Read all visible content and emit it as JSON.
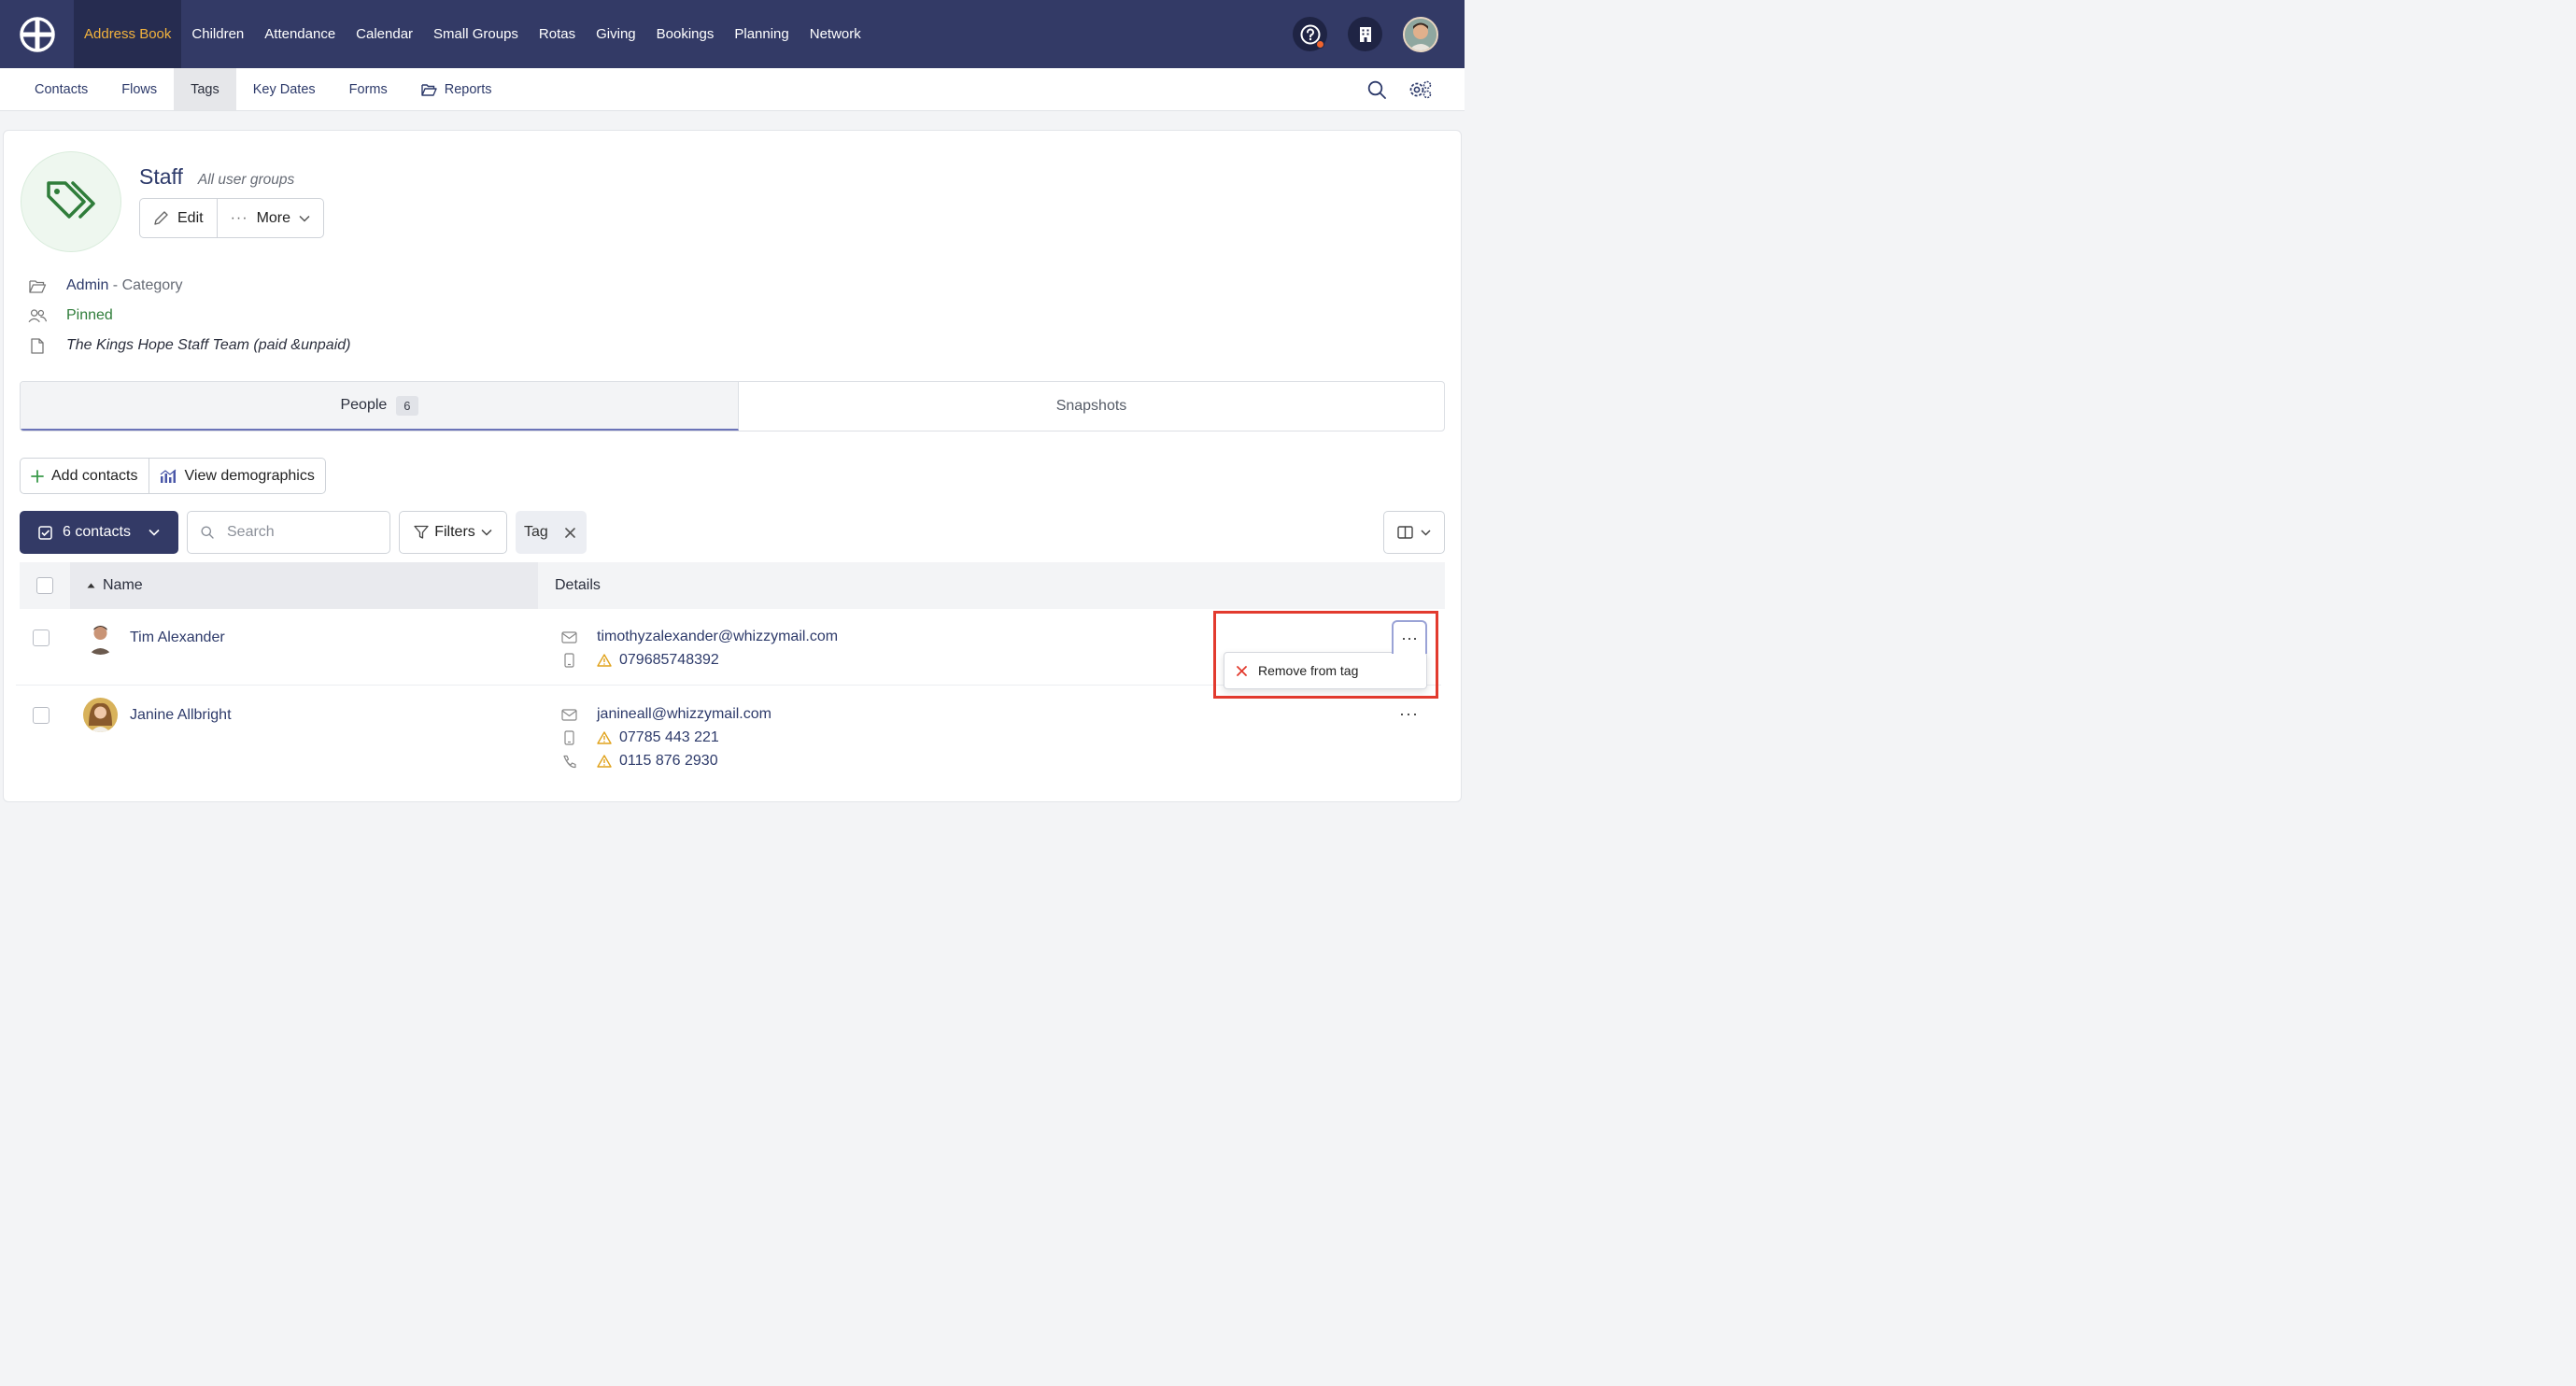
{
  "topnav": {
    "items": [
      "Address Book",
      "Children",
      "Attendance",
      "Calendar",
      "Small Groups",
      "Rotas",
      "Giving",
      "Bookings",
      "Planning",
      "Network"
    ],
    "active": "Address Book"
  },
  "subnav": {
    "items": [
      "Contacts",
      "Flows",
      "Tags",
      "Key Dates",
      "Forms",
      "Reports"
    ],
    "active": "Tags"
  },
  "tag": {
    "name": "Staff",
    "subtitle": "All user groups",
    "edit_label": "Edit",
    "more_label": "More",
    "category_link": "Admin",
    "category_suffix": " - Category",
    "pinned_label": "Pinned",
    "description": "The Kings Hope Staff Team (paid &unpaid)"
  },
  "tabs": {
    "people_label": "People",
    "people_count": "6",
    "snapshots_label": "Snapshots"
  },
  "actions": {
    "add_contacts": "Add contacts",
    "view_demographics": "View demographics"
  },
  "toolbar": {
    "contacts_label": "6 contacts",
    "search_placeholder": "Search",
    "filters_label": "Filters",
    "tag_chip": "Tag"
  },
  "table": {
    "col_name": "Name",
    "col_details": "Details",
    "rows": [
      {
        "name": "Tim Alexander",
        "email": "timothyzalexander@whizzymail.com",
        "mobile": "079685748392",
        "phone": ""
      },
      {
        "name": "Janine Allbright",
        "email": "janineall@whizzymail.com",
        "mobile": "07785 443 221",
        "phone": "0115 876 2930"
      }
    ]
  },
  "row_menu": {
    "remove_label": "Remove from tag"
  },
  "colors": {
    "topbar": "#333a66",
    "active_nav_text": "#f3b33d",
    "link": "#2d3a6a",
    "pinned": "#2f7d3a",
    "warning": "#e0a21b",
    "highlight": "#e23a2e"
  }
}
